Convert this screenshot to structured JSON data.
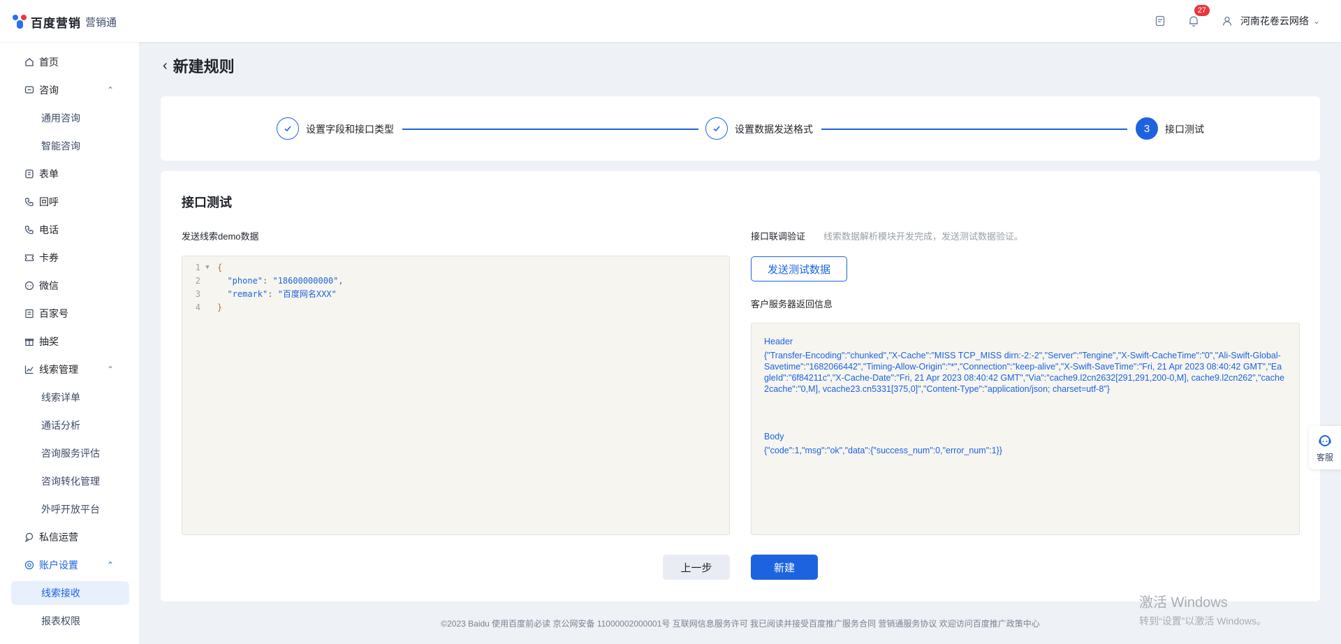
{
  "brand": {
    "main": "百度营销",
    "sub": "营销通"
  },
  "topbar": {
    "notification_count": "27",
    "user_name": "河南花卷云网络"
  },
  "sidebar": {
    "items": [
      {
        "label": "首页",
        "icon": "home-icon"
      },
      {
        "label": "咨询",
        "icon": "chat-icon"
      },
      {
        "label": "通用咨询"
      },
      {
        "label": "智能咨询"
      },
      {
        "label": "表单",
        "icon": "form-icon"
      },
      {
        "label": "回呼",
        "icon": "phone-icon"
      },
      {
        "label": "电话",
        "icon": "phone-icon"
      },
      {
        "label": "卡券",
        "icon": "ticket-icon"
      },
      {
        "label": "微信",
        "icon": "wechat-icon"
      },
      {
        "label": "百家号",
        "icon": "article-icon"
      },
      {
        "label": "抽奖",
        "icon": "gift-icon"
      },
      {
        "label": "线索管理",
        "icon": "chart-icon"
      },
      {
        "label": "线索详单"
      },
      {
        "label": "通话分析"
      },
      {
        "label": "咨询服务评估"
      },
      {
        "label": "咨询转化管理"
      },
      {
        "label": "外呼开放平台"
      },
      {
        "label": "私信运营",
        "icon": "message-icon"
      },
      {
        "label": "账户设置",
        "icon": "settings-icon"
      },
      {
        "label": "线索接收"
      },
      {
        "label": "报表权限"
      }
    ]
  },
  "page": {
    "title": "新建规则"
  },
  "steps": [
    {
      "label": "设置字段和接口类型",
      "status": "done"
    },
    {
      "label": "设置数据发送格式",
      "status": "done"
    },
    {
      "label": "接口测试",
      "status": "current",
      "number": "3"
    }
  ],
  "main": {
    "section_title": "接口测试",
    "left_label": "发送线索demo数据",
    "code": {
      "line_numbers": [
        "1",
        "2",
        "3",
        "4"
      ],
      "open_brace": "{",
      "close_brace": "}",
      "phone_key": "\"phone\"",
      "phone_value": "\"18600000000\"",
      "remark_key": "\"remark\"",
      "remark_value": "\"百度网名XXX\""
    },
    "right_label": "接口联调验证",
    "right_hint": "线索数据解析模块开发完成，发送测试数据验证。",
    "send_button": "发送测试数据",
    "response_label": "客户服务器返回信息",
    "response_header_title": "Header",
    "response_header_value": "{\"Transfer-Encoding\":\"chunked\",\"X-Cache\":\"MISS TCP_MISS dirn:-2:-2\",\"Server\":\"Tengine\",\"X-Swift-CacheTime\":\"0\",\"Ali-Swift-Global-Savetime\":\"1682066442\",\"Timing-Allow-Origin\":\"*\",\"Connection\":\"keep-alive\",\"X-Swift-SaveTime\":\"Fri, 21 Apr 2023 08:40:42 GMT\",\"EagleId\":\"6f84211c\",\"X-Cache-Date\":\"Fri, 21 Apr 2023 08:40:42 GMT\",\"Via\":\"cache9.l2cn2632[291,291,200-0,M], cache9.l2cn262\",\"cache2cache\":\"0,M], vcache23.cn5331[375,0]\",\"Content-Type\":\"application/json; charset=utf-8\"}",
    "response_body_title": "Body",
    "response_body_value": "{\"code\":1,\"msg\":\"ok\",\"data\":{\"success_num\":0,\"error_num\":1}}",
    "prev_button": "上一步",
    "create_button": "新建"
  },
  "footer": "©2023  Baidu  使用百度前必读  京公网安备 11000002000001号  互联网信息服务许可  我已阅读并接受百度推广服务合同  营销通服务协议  欢迎访问百度推广政策中心",
  "service": {
    "label": "客服"
  },
  "watermark": {
    "line1": "激活 Windows",
    "line2": "转到“设置”以激活 Windows。"
  }
}
